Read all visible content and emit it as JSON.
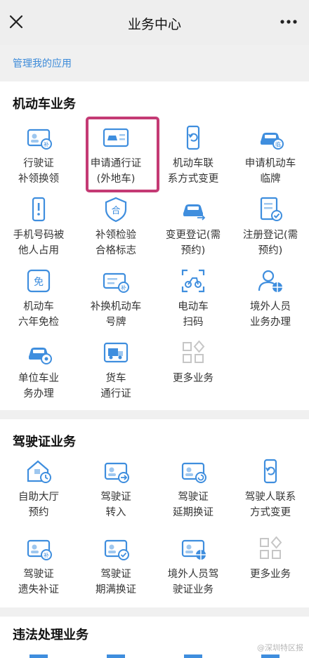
{
  "header": {
    "title": "业务中心",
    "close_icon": "close-icon",
    "more_icon": "more-dots-icon"
  },
  "manage_link": "管理我的应用",
  "colors": {
    "icon_blue": "#3f8ede",
    "link_blue": "#3d8bd9",
    "highlight": "#c43a74"
  },
  "sections": [
    {
      "title": "机动车业务",
      "items": [
        {
          "label": "行驶证\n补领换领",
          "icon": "card-add-icon"
        },
        {
          "label": "申请通行证\n(外地车)",
          "icon": "car-pass-icon"
        },
        {
          "label": "机动车联\n系方式变更",
          "icon": "phone-refresh-icon"
        },
        {
          "label": "申请机动车\n临牌",
          "icon": "car-temp-plate-icon"
        },
        {
          "label": "手机号码被\n他人占用",
          "icon": "phone-alert-icon"
        },
        {
          "label": "补领检验\n合格标志",
          "icon": "shield-pass-icon"
        },
        {
          "label": "变更登记(需\n预约)",
          "icon": "car-change-icon"
        },
        {
          "label": "注册登记(需\n预约)",
          "icon": "doc-check-icon"
        },
        {
          "label": "机动车\n六年免检",
          "icon": "exempt-icon"
        },
        {
          "label": "补换机动车\n号牌",
          "icon": "plate-add-icon"
        },
        {
          "label": "电动车\n扫码",
          "icon": "scan-ebike-icon"
        },
        {
          "label": "境外人员\n业务办理",
          "icon": "person-globe-icon"
        },
        {
          "label": "单位车业\n务办理",
          "icon": "car-org-icon"
        },
        {
          "label": "货车\n通行证",
          "icon": "truck-pass-icon"
        },
        {
          "label": "更多业务",
          "icon": "more-grid-icon"
        }
      ]
    },
    {
      "title": "驾驶证业务",
      "items": [
        {
          "label": "自助大厅\n预约",
          "icon": "hall-clock-icon"
        },
        {
          "label": "驾驶证\n转入",
          "icon": "license-in-icon"
        },
        {
          "label": "驾驶证\n延期换证",
          "icon": "license-renew-icon"
        },
        {
          "label": "驾驶人联系\n方式变更",
          "icon": "phone-refresh-icon"
        },
        {
          "label": "驾驶证\n遗失补证",
          "icon": "license-add-icon"
        },
        {
          "label": "驾驶证\n期满换证",
          "icon": "license-expire-icon"
        },
        {
          "label": "境外人员驾\n驶证业务",
          "icon": "license-globe-icon"
        },
        {
          "label": "更多业务",
          "icon": "more-grid-icon"
        }
      ]
    },
    {
      "title": "违法处理业务",
      "items": []
    }
  ],
  "watermark": "@深圳特区报"
}
